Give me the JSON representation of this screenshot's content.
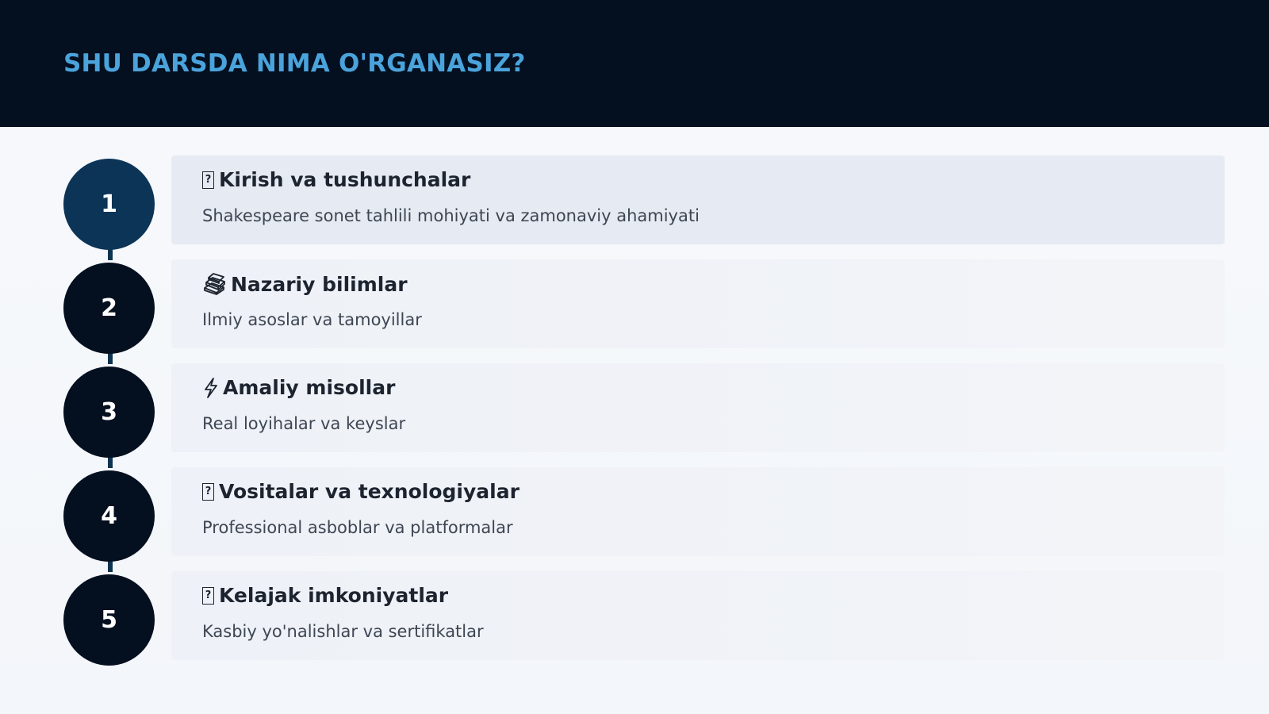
{
  "header": {
    "title": "SHU DARSDA NIMA O'RGANASIZ?"
  },
  "colors": {
    "header_bg": "#040f1f",
    "title": "#4aa3db",
    "circle_active": "#0c3457",
    "circle": "#040f1f",
    "connector": "#0d3550"
  },
  "items": [
    {
      "number": "1",
      "icon": "missing-glyph-icon",
      "title": "Kirish va tushunchalar",
      "description": "Shakespeare sonet tahlili mohiyati va zamonaviy ahamiyati",
      "active": true
    },
    {
      "number": "2",
      "icon": "books-icon",
      "title": "Nazariy bilimlar",
      "description": "Ilmiy asoslar va tamoyillar",
      "active": false
    },
    {
      "number": "3",
      "icon": "lightning-icon",
      "title": "Amaliy misollar",
      "description": "Real loyihalar va keyslar",
      "active": false
    },
    {
      "number": "4",
      "icon": "missing-glyph-icon",
      "title": "Vositalar va texnologiyalar",
      "description": "Professional asboblar va platformalar",
      "active": false
    },
    {
      "number": "5",
      "icon": "missing-glyph-icon",
      "title": "Kelajak imkoniyatlar",
      "description": "Kasbiy yo'nalishlar va sertifikatlar",
      "active": false
    }
  ]
}
